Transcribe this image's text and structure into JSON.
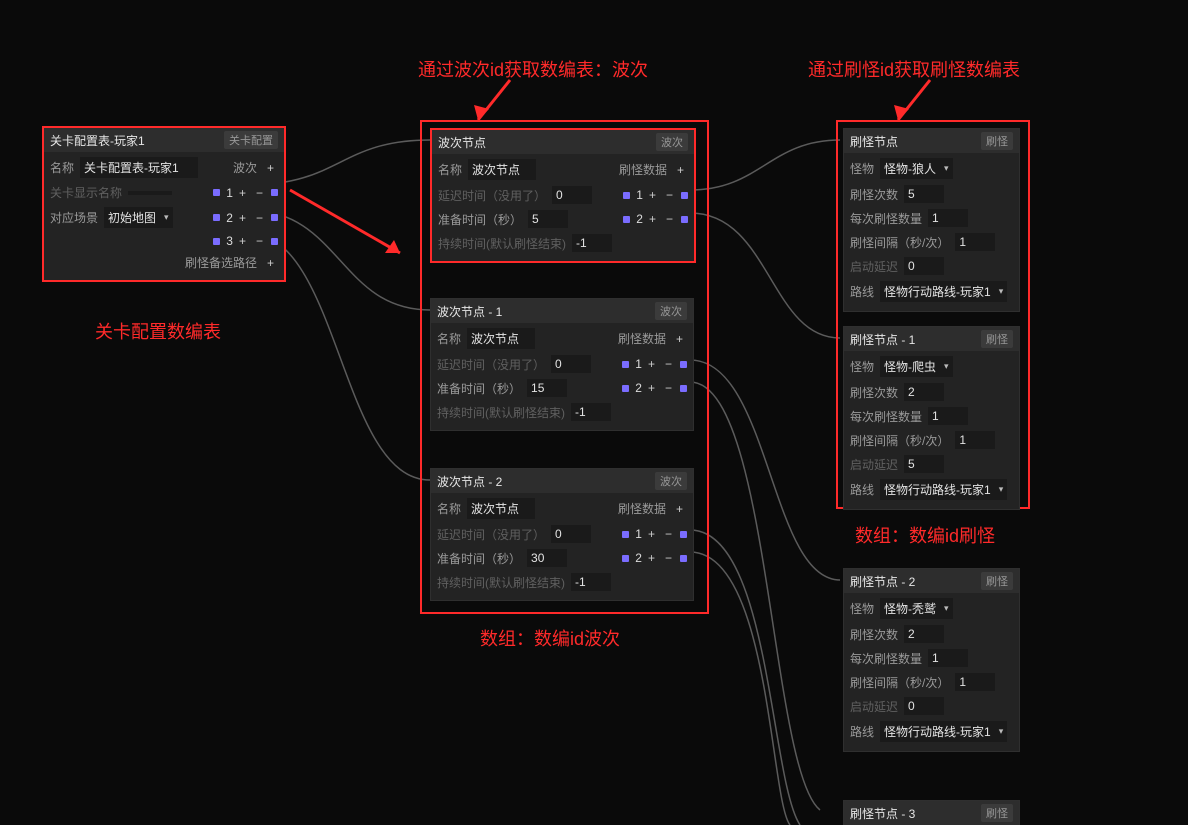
{
  "annotations": {
    "top_center": "通过波次id获取数编表：波次",
    "top_right": "通过刷怪id获取刷怪数编表",
    "left_caption": "关卡配置数编表",
    "mid_caption": "数组：数编id波次",
    "right_caption": "数组：数编id刷怪"
  },
  "level_node": {
    "title": "关卡配置表-玩家1",
    "tag": "关卡配置",
    "name_label": "名称",
    "name_value": "关卡配置表-玩家1",
    "display_label": "关卡显示名称",
    "scene_label": "对应场景",
    "scene_value": "初始地图",
    "wave_list_label": "波次",
    "wave_numbers": [
      "1",
      "2",
      "3"
    ],
    "alt_path_label": "刷怪备选路径"
  },
  "wave_nodes": [
    {
      "title": "波次节点",
      "tag": "波次",
      "name_label": "名称",
      "name_value": "波次节点",
      "list_label": "刷怪数据",
      "delay_label": "延迟时间（没用了）",
      "delay_value": "0",
      "prepare_label": "准备时间（秒）",
      "prepare_value": "5",
      "duration_label": "持续时间(默认刷怪结束)",
      "duration_value": "-1",
      "list_items": [
        "1",
        "2"
      ]
    },
    {
      "title": "波次节点 - 1",
      "tag": "波次",
      "name_label": "名称",
      "name_value": "波次节点",
      "list_label": "刷怪数据",
      "delay_label": "延迟时间（没用了）",
      "delay_value": "0",
      "prepare_label": "准备时间（秒）",
      "prepare_value": "15",
      "duration_label": "持续时间(默认刷怪结束)",
      "duration_value": "-1",
      "list_items": [
        "1",
        "2"
      ]
    },
    {
      "title": "波次节点 - 2",
      "tag": "波次",
      "name_label": "名称",
      "name_value": "波次节点",
      "list_label": "刷怪数据",
      "delay_label": "延迟时间（没用了）",
      "delay_value": "0",
      "prepare_label": "准备时间（秒）",
      "prepare_value": "30",
      "duration_label": "持续时间(默认刷怪结束)",
      "duration_value": "-1",
      "list_items": [
        "1",
        "2"
      ]
    }
  ],
  "spawn_nodes": [
    {
      "title": "刷怪节点",
      "tag": "刷怪",
      "monster_label": "怪物",
      "monster_value": "怪物-狼人",
      "count_label": "刷怪次数",
      "count_value": "5",
      "per_label": "每次刷怪数量",
      "per_value": "1",
      "interval_label": "刷怪间隔（秒/次）",
      "interval_value": "1",
      "start_delay_label": "启动延迟",
      "start_delay_value": "0",
      "route_label": "路线",
      "route_value": "怪物行动路线-玩家1"
    },
    {
      "title": "刷怪节点 - 1",
      "tag": "刷怪",
      "monster_label": "怪物",
      "monster_value": "怪物-爬虫",
      "count_label": "刷怪次数",
      "count_value": "2",
      "per_label": "每次刷怪数量",
      "per_value": "1",
      "interval_label": "刷怪间隔（秒/次）",
      "interval_value": "1",
      "start_delay_label": "启动延迟",
      "start_delay_value": "5",
      "route_label": "路线",
      "route_value": "怪物行动路线-玩家1"
    },
    {
      "title": "刷怪节点 - 2",
      "tag": "刷怪",
      "monster_label": "怪物",
      "monster_value": "怪物-秃鹫",
      "count_label": "刷怪次数",
      "count_value": "2",
      "per_label": "每次刷怪数量",
      "per_value": "1",
      "interval_label": "刷怪间隔（秒/次）",
      "interval_value": "1",
      "start_delay_label": "启动延迟",
      "start_delay_value": "0",
      "route_label": "路线",
      "route_value": "怪物行动路线-玩家1"
    },
    {
      "title": "刷怪节点 - 3",
      "tag": "刷怪"
    }
  ]
}
